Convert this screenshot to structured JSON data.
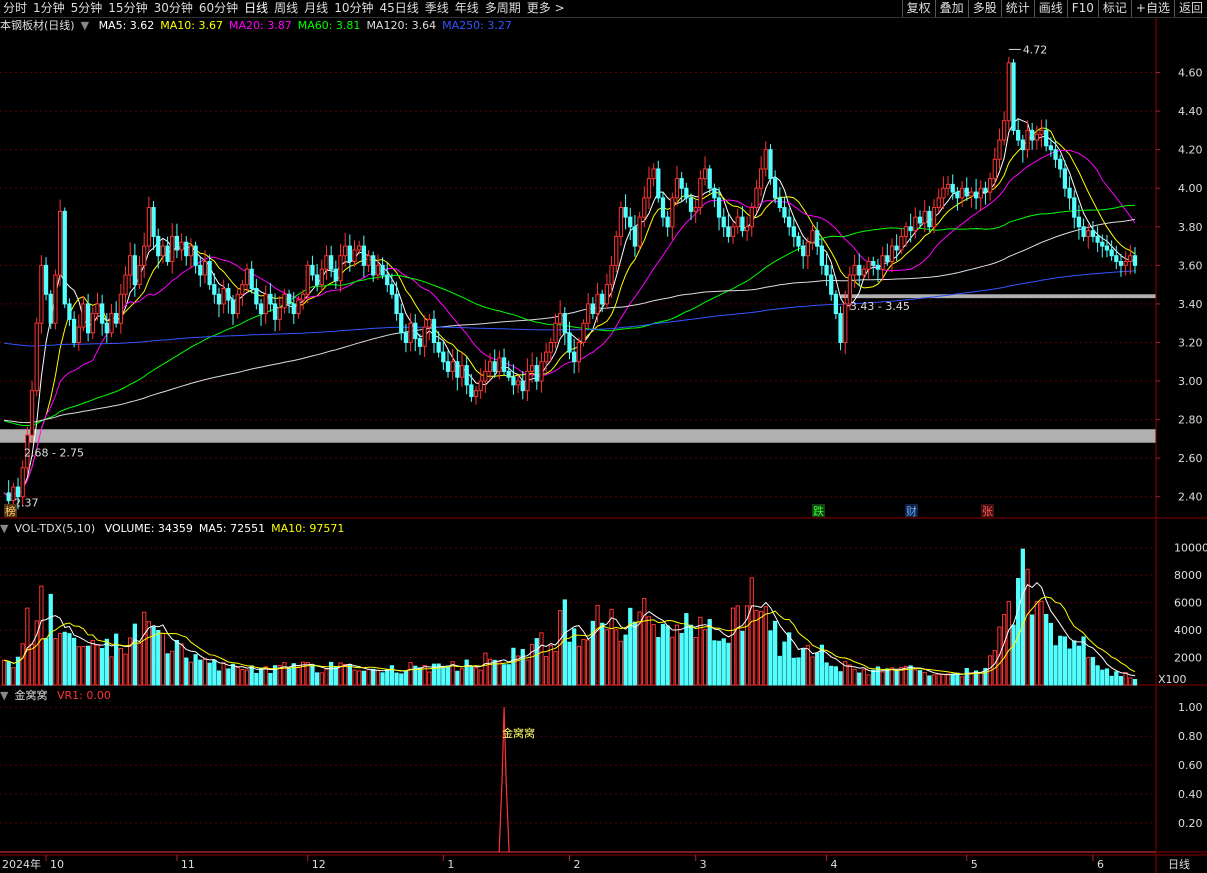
{
  "toolbar": {
    "periods": [
      "分时",
      "1分钟",
      "5分钟",
      "15分钟",
      "30分钟",
      "60分钟",
      "日线",
      "周线",
      "月线",
      "10分钟",
      "45日线",
      "季线",
      "年线",
      "多周期",
      "更多 >"
    ],
    "active": "日线",
    "right": [
      "复权",
      "叠加",
      "多股",
      "统计",
      "画线",
      "F10",
      "标记",
      "+自选",
      "返回"
    ]
  },
  "main_info": {
    "title": "本钢板材(日线)",
    "ma": [
      {
        "label": "MA5: 3.62",
        "color": "#ffffff"
      },
      {
        "label": "MA10: 3.67",
        "color": "#ffff00"
      },
      {
        "label": "MA20: 3.87",
        "color": "#ff00ff"
      },
      {
        "label": "MA60: 3.81",
        "color": "#00ff00"
      },
      {
        "label": "MA120: 3.64",
        "color": "#dddddd"
      },
      {
        "label": "MA250: 3.27",
        "color": "#3355ff"
      }
    ]
  },
  "vol_info": {
    "title": "VOL-TDX(5,10)",
    "items": [
      {
        "label": "VOLUME: 34359",
        "color": "#ffffff"
      },
      {
        "label": "MA5: 72551",
        "color": "#ffffff"
      },
      {
        "label": "MA10: 97571",
        "color": "#ffff00"
      }
    ]
  },
  "ind_info": {
    "title": "金窝窝",
    "items": [
      {
        "label": "VR1: 0.00",
        "color": "#ff3333"
      }
    ]
  },
  "annotations": {
    "high": "4.72",
    "low": "2.37",
    "zone1": "2.68 - 2.75",
    "zone2": "3.43 - 3.45",
    "signal": "金窝窝",
    "vol_unit": "X100",
    "bottom_right": "日线"
  },
  "markers": [
    {
      "text": "榜",
      "color": "#ffcc66",
      "bg": "#553311"
    },
    {
      "text": "跌",
      "color": "#33ff33",
      "bg": "#114411"
    },
    {
      "text": "财",
      "color": "#66aaff",
      "bg": "#112244"
    },
    {
      "text": "张",
      "color": "#ff5555",
      "bg": "#441111"
    }
  ],
  "chart_data": [
    {
      "type": "candlestick",
      "title": "本钢板材(日线)",
      "ylim": [
        2.3,
        4.8
      ],
      "yticks": [
        2.4,
        2.6,
        2.8,
        3.0,
        3.2,
        3.4,
        3.6,
        3.8,
        4.0,
        4.2,
        4.4,
        4.6
      ],
      "zones": [
        {
          "label": "2.68 - 2.75",
          "low": 2.68,
          "high": 2.75
        },
        {
          "label": "3.43 - 3.45",
          "low": 3.43,
          "high": 3.45
        }
      ],
      "x_labels": [
        "2024年",
        "10",
        "11",
        "12",
        "1",
        "2",
        "3",
        "4",
        "5",
        "6"
      ],
      "x_label_index": [
        0,
        9,
        37,
        65,
        94,
        121,
        148,
        176,
        206,
        233
      ],
      "close_path": [
        [
          0,
          2.42
        ],
        [
          1,
          2.38
        ],
        [
          2,
          2.45
        ],
        [
          3,
          2.4
        ],
        [
          4,
          2.55
        ],
        [
          5,
          2.72
        ],
        [
          6,
          2.95
        ],
        [
          7,
          3.3
        ],
        [
          8,
          3.6
        ],
        [
          9,
          3.45
        ],
        [
          10,
          3.3
        ],
        [
          11,
          3.55
        ],
        [
          12,
          3.88
        ],
        [
          13,
          3.4
        ],
        [
          14,
          3.32
        ],
        [
          15,
          3.2
        ],
        [
          16,
          3.28
        ],
        [
          17,
          3.4
        ],
        [
          18,
          3.25
        ],
        [
          19,
          3.35
        ],
        [
          20,
          3.4
        ],
        [
          21,
          3.3
        ],
        [
          22,
          3.25
        ],
        [
          23,
          3.35
        ],
        [
          24,
          3.3
        ],
        [
          25,
          3.45
        ],
        [
          26,
          3.55
        ],
        [
          27,
          3.65
        ],
        [
          28,
          3.5
        ],
        [
          29,
          3.6
        ],
        [
          30,
          3.7
        ],
        [
          31,
          3.9
        ],
        [
          32,
          3.75
        ],
        [
          33,
          3.65
        ],
        [
          34,
          3.7
        ],
        [
          35,
          3.62
        ],
        [
          36,
          3.75
        ],
        [
          37,
          3.68
        ],
        [
          38,
          3.72
        ],
        [
          39,
          3.65
        ],
        [
          40,
          3.7
        ],
        [
          41,
          3.6
        ],
        [
          42,
          3.55
        ],
        [
          43,
          3.62
        ],
        [
          44,
          3.5
        ],
        [
          45,
          3.45
        ],
        [
          46,
          3.4
        ],
        [
          47,
          3.48
        ],
        [
          48,
          3.42
        ],
        [
          49,
          3.35
        ],
        [
          50,
          3.45
        ],
        [
          51,
          3.5
        ],
        [
          52,
          3.58
        ],
        [
          53,
          3.48
        ],
        [
          54,
          3.4
        ],
        [
          55,
          3.35
        ],
        [
          56,
          3.45
        ],
        [
          57,
          3.4
        ],
        [
          58,
          3.32
        ],
        [
          59,
          3.38
        ],
        [
          60,
          3.45
        ],
        [
          61,
          3.4
        ],
        [
          62,
          3.35
        ],
        [
          63,
          3.42
        ],
        [
          64,
          3.45
        ],
        [
          65,
          3.6
        ],
        [
          66,
          3.55
        ],
        [
          67,
          3.5
        ],
        [
          68,
          3.58
        ],
        [
          69,
          3.65
        ],
        [
          70,
          3.58
        ],
        [
          71,
          3.52
        ],
        [
          72,
          3.65
        ],
        [
          73,
          3.7
        ],
        [
          74,
          3.62
        ],
        [
          75,
          3.68
        ],
        [
          76,
          3.7
        ],
        [
          77,
          3.6
        ],
        [
          78,
          3.65
        ],
        [
          79,
          3.55
        ],
        [
          80,
          3.6
        ],
        [
          81,
          3.55
        ],
        [
          82,
          3.5
        ],
        [
          83,
          3.45
        ],
        [
          84,
          3.35
        ],
        [
          85,
          3.25
        ],
        [
          86,
          3.2
        ],
        [
          87,
          3.3
        ],
        [
          88,
          3.22
        ],
        [
          89,
          3.18
        ],
        [
          90,
          3.28
        ],
        [
          91,
          3.32
        ],
        [
          92,
          3.2
        ],
        [
          93,
          3.15
        ],
        [
          94,
          3.1
        ],
        [
          95,
          3.05
        ],
        [
          96,
          3.1
        ],
        [
          97,
          3.02
        ],
        [
          98,
          3.08
        ],
        [
          99,
          2.98
        ],
        [
          100,
          2.92
        ],
        [
          101,
          2.95
        ],
        [
          102,
          3.0
        ],
        [
          103,
          3.05
        ],
        [
          104,
          3.1
        ],
        [
          105,
          3.05
        ],
        [
          106,
          3.12
        ],
        [
          107,
          3.05
        ],
        [
          108,
          3.02
        ],
        [
          109,
          2.98
        ],
        [
          110,
          3.0
        ],
        [
          111,
          2.95
        ],
        [
          112,
          3.05
        ],
        [
          113,
          3.08
        ],
        [
          114,
          3.0
        ],
        [
          115,
          3.1
        ],
        [
          116,
          3.15
        ],
        [
          117,
          3.2
        ],
        [
          118,
          3.3
        ],
        [
          119,
          3.35
        ],
        [
          120,
          3.25
        ],
        [
          121,
          3.15
        ],
        [
          122,
          3.1
        ],
        [
          123,
          3.2
        ],
        [
          124,
          3.3
        ],
        [
          125,
          3.4
        ],
        [
          126,
          3.35
        ],
        [
          127,
          3.45
        ],
        [
          128,
          3.4
        ],
        [
          129,
          3.5
        ],
        [
          130,
          3.6
        ],
        [
          131,
          3.75
        ],
        [
          132,
          3.9
        ],
        [
          133,
          3.85
        ],
        [
          134,
          3.8
        ],
        [
          135,
          3.7
        ],
        [
          136,
          3.85
        ],
        [
          137,
          3.95
        ],
        [
          138,
          4.05
        ],
        [
          139,
          4.1
        ],
        [
          140,
          3.95
        ],
        [
          141,
          3.85
        ],
        [
          142,
          3.8
        ],
        [
          143,
          3.95
        ],
        [
          144,
          4.05
        ],
        [
          145,
          4.0
        ],
        [
          146,
          3.95
        ],
        [
          147,
          3.88
        ],
        [
          148,
          3.9
        ],
        [
          149,
          4.05
        ],
        [
          150,
          4.1
        ],
        [
          151,
          4.0
        ],
        [
          152,
          3.95
        ],
        [
          153,
          3.85
        ],
        [
          154,
          3.8
        ],
        [
          155,
          3.75
        ],
        [
          156,
          3.8
        ],
        [
          157,
          3.85
        ],
        [
          158,
          3.78
        ],
        [
          159,
          3.8
        ],
        [
          160,
          3.9
        ],
        [
          161,
          4.0
        ],
        [
          162,
          4.1
        ],
        [
          163,
          4.2
        ],
        [
          164,
          4.05
        ],
        [
          165,
          3.95
        ],
        [
          166,
          3.9
        ],
        [
          167,
          3.85
        ],
        [
          168,
          3.8
        ],
        [
          169,
          3.75
        ],
        [
          170,
          3.7
        ],
        [
          171,
          3.65
        ],
        [
          172,
          3.72
        ],
        [
          173,
          3.78
        ],
        [
          174,
          3.7
        ],
        [
          175,
          3.6
        ],
        [
          176,
          3.55
        ],
        [
          177,
          3.45
        ],
        [
          178,
          3.35
        ],
        [
          179,
          3.2
        ],
        [
          180,
          3.4
        ],
        [
          181,
          3.55
        ],
        [
          182,
          3.6
        ],
        [
          183,
          3.55
        ],
        [
          184,
          3.58
        ],
        [
          185,
          3.62
        ],
        [
          186,
          3.6
        ],
        [
          187,
          3.58
        ],
        [
          188,
          3.65
        ],
        [
          189,
          3.62
        ],
        [
          190,
          3.7
        ],
        [
          191,
          3.68
        ],
        [
          192,
          3.75
        ],
        [
          193,
          3.8
        ],
        [
          194,
          3.78
        ],
        [
          195,
          3.85
        ],
        [
          196,
          3.82
        ],
        [
          197,
          3.88
        ],
        [
          198,
          3.8
        ],
        [
          199,
          3.9
        ],
        [
          200,
          3.95
        ],
        [
          201,
          4.0
        ],
        [
          202,
          4.02
        ],
        [
          203,
          3.98
        ],
        [
          204,
          3.95
        ],
        [
          205,
          4.0
        ],
        [
          206,
          3.96
        ],
        [
          207,
          3.98
        ],
        [
          208,
          3.95
        ],
        [
          209,
          4.0
        ],
        [
          210,
          3.98
        ],
        [
          211,
          4.05
        ],
        [
          212,
          4.15
        ],
        [
          213,
          4.25
        ],
        [
          214,
          4.35
        ],
        [
          215,
          4.65
        ],
        [
          216,
          4.3
        ],
        [
          217,
          4.25
        ],
        [
          218,
          4.2
        ],
        [
          219,
          4.3
        ],
        [
          220,
          4.25
        ],
        [
          221,
          4.28
        ],
        [
          222,
          4.3
        ],
        [
          223,
          4.22
        ],
        [
          224,
          4.2
        ],
        [
          225,
          4.15
        ],
        [
          226,
          4.1
        ],
        [
          227,
          4.0
        ],
        [
          228,
          3.95
        ],
        [
          229,
          3.85
        ],
        [
          230,
          3.8
        ],
        [
          231,
          3.75
        ],
        [
          232,
          3.78
        ],
        [
          233,
          3.75
        ],
        [
          234,
          3.72
        ],
        [
          235,
          3.7
        ],
        [
          236,
          3.68
        ],
        [
          237,
          3.65
        ],
        [
          238,
          3.62
        ],
        [
          239,
          3.6
        ],
        [
          240,
          3.62
        ],
        [
          241,
          3.65
        ],
        [
          242,
          3.6
        ]
      ]
    },
    {
      "type": "bar",
      "title": "VOL-TDX(5,10)",
      "ylim": [
        0,
        11000
      ],
      "yticks": [
        2000,
        4000,
        6000,
        8000,
        10000
      ],
      "peaks": [
        [
          0,
          1800
        ],
        [
          4,
          3000
        ],
        [
          5,
          5600
        ],
        [
          8,
          7200
        ],
        [
          10,
          6600
        ],
        [
          15,
          3400
        ],
        [
          30,
          5300
        ],
        [
          45,
          1800
        ],
        [
          96,
          1700
        ],
        [
          115,
          3800
        ],
        [
          120,
          6200
        ],
        [
          127,
          5800
        ],
        [
          137,
          6300
        ],
        [
          146,
          5200
        ],
        [
          156,
          5600
        ],
        [
          160,
          7800
        ],
        [
          163,
          5700
        ],
        [
          168,
          3800
        ],
        [
          175,
          2900
        ],
        [
          180,
          1700
        ],
        [
          210,
          1200
        ],
        [
          218,
          9900
        ],
        [
          222,
          6100
        ],
        [
          227,
          3500
        ],
        [
          231,
          3500
        ],
        [
          233,
          2000
        ],
        [
          240,
          900
        ],
        [
          242,
          400
        ]
      ]
    },
    {
      "type": "line",
      "title": "金窝窝",
      "ylim": [
        0,
        1.05
      ],
      "yticks": [
        0.2,
        0.4,
        0.6,
        0.8,
        1.0
      ],
      "signals": [
        {
          "x": 107,
          "value": 1.0
        }
      ]
    }
  ]
}
